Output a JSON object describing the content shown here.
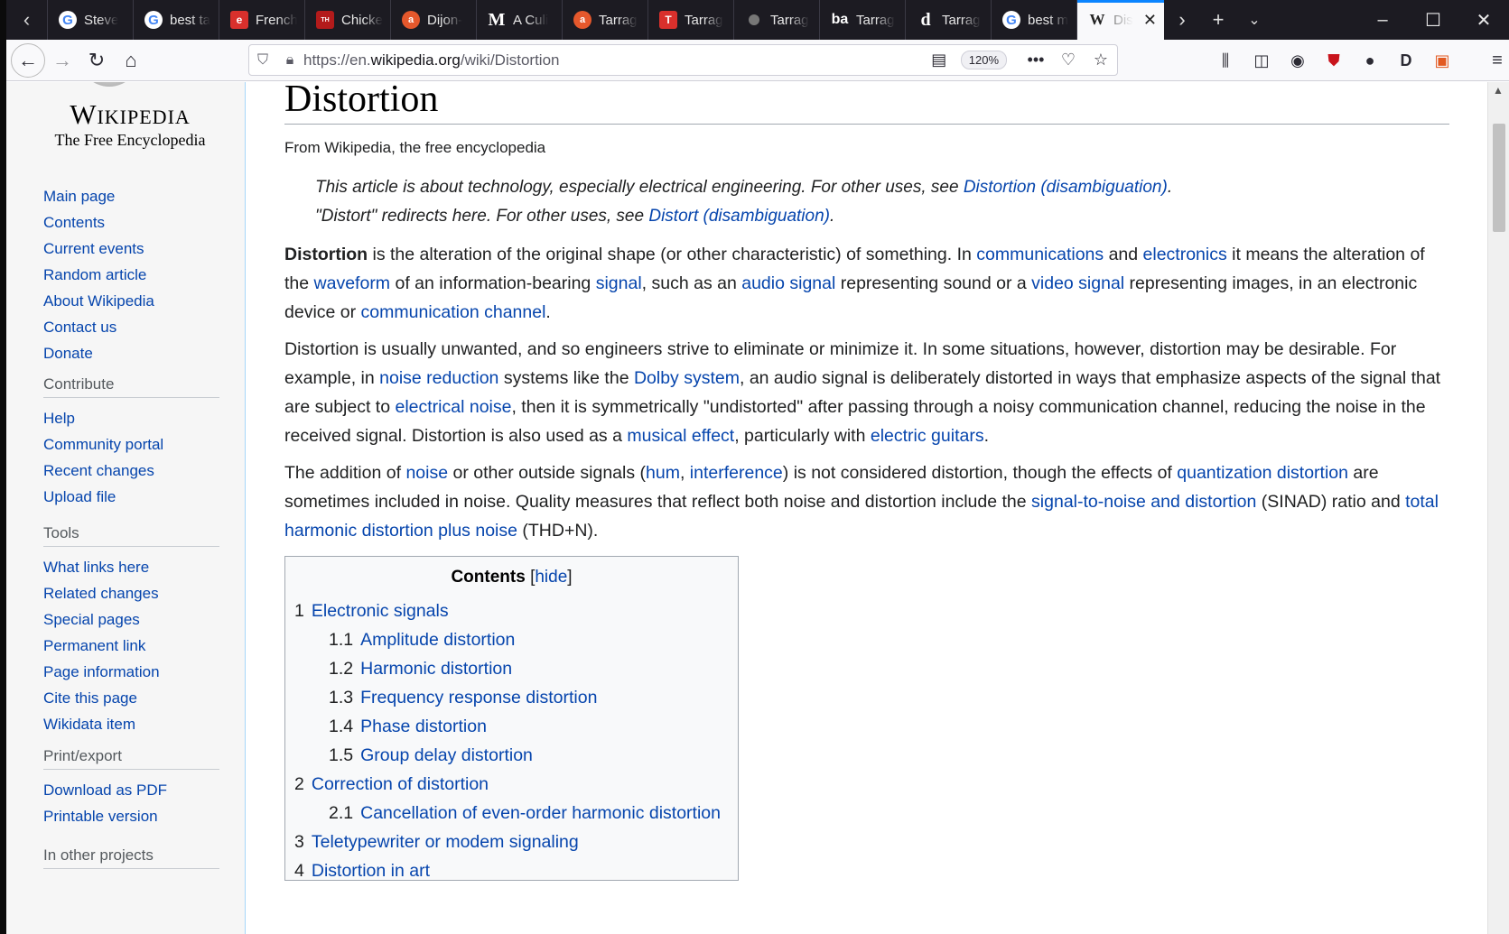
{
  "tabs": [
    {
      "label": "Steve",
      "icon": "google-icon"
    },
    {
      "label": "best ta",
      "icon": "google-icon"
    },
    {
      "label": "French",
      "icon": "epicurious-icon"
    },
    {
      "label": "Chicke",
      "icon": "tasteofhome-icon"
    },
    {
      "label": "Dijon-",
      "icon": "allrecipes-icon"
    },
    {
      "label": "A Culi",
      "icon": "masterclass-icon"
    },
    {
      "label": "Tarrag",
      "icon": "allrecipes-icon"
    },
    {
      "label": "Tarrag",
      "icon": "nytcooking-icon"
    },
    {
      "label": "Tarrag",
      "icon": "site-icon"
    },
    {
      "label": "Tarrag",
      "icon": "bonappetit-icon"
    },
    {
      "label": "Tarrag",
      "icon": "delish-icon"
    },
    {
      "label": "best m",
      "icon": "google-icon"
    },
    {
      "label": "Dis",
      "icon": "wikipedia-icon",
      "active": true
    }
  ],
  "navbar": {
    "url_prefix": "https://en.",
    "url_domain": "wikipedia.org",
    "url_path": "/wiki/Distortion",
    "zoom": "120%"
  },
  "logo": {
    "wordmark": "Wikipedia",
    "tagline": "The Free Encyclopedia"
  },
  "sidebar": {
    "navigation": [
      "Main page",
      "Contents",
      "Current events",
      "Random article",
      "About Wikipedia",
      "Contact us",
      "Donate"
    ],
    "contribute_head": "Contribute",
    "contribute": [
      "Help",
      "Community portal",
      "Recent changes",
      "Upload file"
    ],
    "tools_head": "Tools",
    "tools": [
      "What links here",
      "Related changes",
      "Special pages",
      "Permanent link",
      "Page information",
      "Cite this page",
      "Wikidata item"
    ],
    "print_head": "Print/export",
    "print": [
      "Download as PDF",
      "Printable version"
    ],
    "other_head": "In other projects"
  },
  "article": {
    "title": "Distortion",
    "tagline": "From Wikipedia, the free encyclopedia",
    "hatnote1_text": "This article is about technology, especially electrical engineering. For other uses, see ",
    "hatnote1_link": "Distortion (disambiguation)",
    "hatnote2_text": "\"Distort\" redirects here. For other uses, see ",
    "hatnote2_link": "Distort (disambiguation)",
    "p1": {
      "bold": "Distortion",
      "t1": " is the alteration of the original shape (or other characteristic) of something. In ",
      "l1": "communications",
      "t2": " and ",
      "l2": "electronics",
      "t3": " it means the alteration of the ",
      "l3": "waveform",
      "t4": " of an information-bearing ",
      "l4": "signal",
      "t5": ", such as an ",
      "l5": "audio signal",
      "t6": " representing sound or a ",
      "l6": "video signal",
      "t7": " representing images, in an electronic device or ",
      "l7": "communication channel",
      "t8": "."
    },
    "p2": {
      "t1": "Distortion is usually unwanted, and so engineers strive to eliminate or minimize it. In some situations, however, distortion may be desirable. For example, in ",
      "l1": "noise reduction",
      "t2": " systems like the ",
      "l2": "Dolby system",
      "t3": ", an audio signal is deliberately distorted in ways that emphasize aspects of the signal that are subject to ",
      "l3": "electrical noise",
      "t4": ", then it is symmetrically \"undistorted\" after passing through a noisy communication channel, reducing the noise in the received signal. Distortion is also used as a ",
      "l4": "musical effect",
      "t5": ", particularly with ",
      "l5": "electric guitars",
      "t6": "."
    },
    "p3": {
      "t1": "The addition of ",
      "l1": "noise",
      "t2": " or other outside signals (",
      "l2": "hum",
      "t3": ", ",
      "l3": "interference",
      "t4": ") is not considered distortion, though the effects of ",
      "l4": "quantization distortion",
      "t5": " are sometimes included in noise. Quality measures that reflect both noise and distortion include the ",
      "l5": "signal-to-noise and distortion",
      "t6": " (SINAD) ratio and ",
      "l6": "total harmonic distortion plus noise",
      "t7": " (THD+N)."
    }
  },
  "toc": {
    "title": "Contents",
    "hide_open": "[",
    "hide": "hide",
    "hide_close": "]",
    "items": [
      {
        "num": "1",
        "label": "Electronic signals",
        "level": 1
      },
      {
        "num": "1.1",
        "label": "Amplitude distortion",
        "level": 2
      },
      {
        "num": "1.2",
        "label": "Harmonic distortion",
        "level": 2
      },
      {
        "num": "1.3",
        "label": "Frequency response distortion",
        "level": 2
      },
      {
        "num": "1.4",
        "label": "Phase distortion",
        "level": 2
      },
      {
        "num": "1.5",
        "label": "Group delay distortion",
        "level": 2
      },
      {
        "num": "2",
        "label": "Correction of distortion",
        "level": 1
      },
      {
        "num": "2.1",
        "label": "Cancellation of even-order harmonic distortion",
        "level": 2
      },
      {
        "num": "3",
        "label": "Teletypewriter or modem signaling",
        "level": 1
      },
      {
        "num": "4",
        "label": "Distortion in art",
        "level": 1
      }
    ]
  }
}
